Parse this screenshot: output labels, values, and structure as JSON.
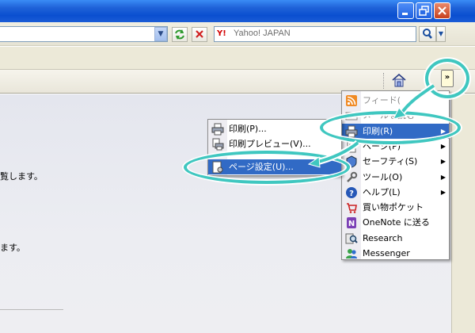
{
  "search": {
    "placeholder": "Yahoo! JAPAN",
    "logo": "Y!"
  },
  "command_bar": {
    "chevron": "»"
  },
  "content": {
    "line1": "覧します。",
    "line2": "ます。"
  },
  "tools_menu": {
    "items": [
      {
        "label": "フィード(",
        "icon": "feed-icon",
        "disabled": true
      },
      {
        "label": "メールを読む",
        "icon": "mail-icon",
        "disabled": true
      },
      {
        "label": "印刷(R)",
        "icon": "print-icon",
        "highlighted": true,
        "submenu": true
      },
      {
        "label": "ページ(P)",
        "icon": "page-icon",
        "submenu": true
      },
      {
        "label": "セーフティ(S)",
        "icon": "safety-icon",
        "submenu": true
      },
      {
        "label": "ツール(O)",
        "icon": "tools-icon",
        "submenu": true
      },
      {
        "label": "ヘルプ(L)",
        "icon": "help-icon",
        "submenu": true
      },
      {
        "label": "買い物ポケット",
        "icon": "shopping-icon"
      },
      {
        "label": "OneNote に送る",
        "icon": "onenote-icon"
      },
      {
        "label": "Research",
        "icon": "research-icon"
      },
      {
        "label": "Messenger",
        "icon": "messenger-icon"
      }
    ]
  },
  "print_menu": {
    "items": [
      {
        "label": "印刷(P)...",
        "icon": "printer-icon"
      },
      {
        "label": "印刷プレビュー(V)...",
        "icon": "print-preview-icon"
      },
      {
        "label": "ページ設定(U)...",
        "icon": "page-setup-icon",
        "highlighted": true
      }
    ]
  },
  "colors": {
    "titlebar": "#0a4fd0",
    "highlight": "#316ac5",
    "callout": "#3fc7c0"
  }
}
